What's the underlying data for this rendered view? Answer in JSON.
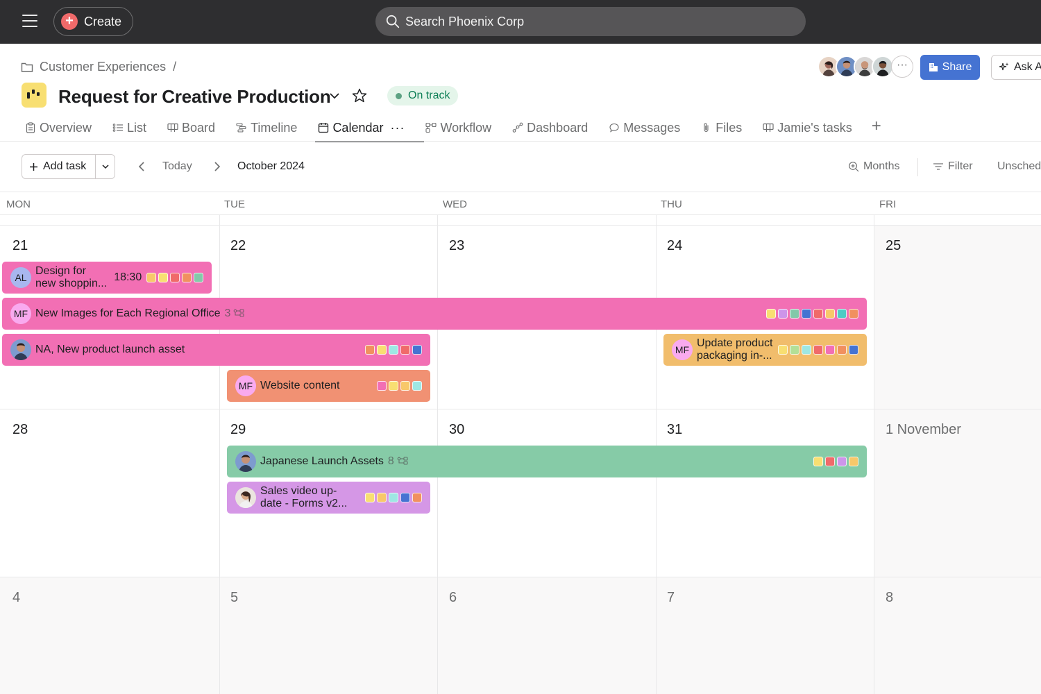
{
  "topbar": {
    "create_label": "Create",
    "search_placeholder": "Search Phoenix Corp"
  },
  "breadcrumb": {
    "parent": "Customer Experiences",
    "separator": "/"
  },
  "project": {
    "title": "Request for Creative Production",
    "status": "On track",
    "status_color": "#5da283",
    "share_label": "Share",
    "ask_label": "Ask AI"
  },
  "tabs": [
    {
      "label": "Overview",
      "icon": "clipboard-icon"
    },
    {
      "label": "List",
      "icon": "list-icon"
    },
    {
      "label": "Board",
      "icon": "board-icon"
    },
    {
      "label": "Timeline",
      "icon": "timeline-icon"
    },
    {
      "label": "Calendar",
      "icon": "calendar-icon",
      "active": true
    },
    {
      "label": "Workflow",
      "icon": "workflow-icon"
    },
    {
      "label": "Dashboard",
      "icon": "dashboard-icon"
    },
    {
      "label": "Messages",
      "icon": "message-icon"
    },
    {
      "label": "Files",
      "icon": "paperclip-icon"
    },
    {
      "label": "Jamie's tasks",
      "icon": "board-icon"
    }
  ],
  "toolbar": {
    "add_task": "Add task",
    "today": "Today",
    "month": "October 2024",
    "months": "Months",
    "filter": "Filter",
    "unscheduled": "Unscheduled"
  },
  "calendar": {
    "weekdays": [
      "MON",
      "TUE",
      "WED",
      "THU",
      "FRI"
    ],
    "weeks": [
      [
        "21",
        "22",
        "23",
        "24",
        "25"
      ],
      [
        "28",
        "29",
        "30",
        "31",
        "1 November"
      ],
      [
        "4",
        "5",
        "6",
        "7",
        "8"
      ]
    ]
  },
  "tasks": [
    {
      "title_line1": "Design for",
      "title_line2": "new shoppin...",
      "time": "18:30",
      "assignee": "AL",
      "color": "#f26fb4",
      "tags": [
        "#f8c86a",
        "#f8df72",
        "#f06a6a",
        "#f1905f",
        "#83c9a9"
      ]
    },
    {
      "title": "New Images for Each Regional Office",
      "subtasks": "3",
      "assignee": "MF",
      "color": "#f26fb4",
      "tags": [
        "#f8df72",
        "#cd95ea",
        "#83c9a9",
        "#4573d2",
        "#f06a6a",
        "#f8c86a",
        "#4ecbc4",
        "#f1905f"
      ]
    },
    {
      "title": "NA, New product launch asset",
      "color": "#f26fb4",
      "tags": [
        "#f1905f",
        "#f8df72",
        "#9ee7e3",
        "#f06a6a",
        "#4573d2"
      ]
    },
    {
      "title": "Website content",
      "assignee": "MF",
      "color": "#f19173",
      "tags": [
        "#f26fb4",
        "#f8df72",
        "#f8c86a",
        "#9ee7e3"
      ]
    },
    {
      "title_line1": "Update product",
      "title_line2": "packaging in-...",
      "assignee": "MF",
      "color": "#f1bd6c",
      "tags": [
        "#f8df72",
        "#b3df97",
        "#9ee7e3",
        "#f06a6a",
        "#f26fb4",
        "#f1905f",
        "#4573d2"
      ]
    },
    {
      "title": "Japanese Launch Assets",
      "subtasks": "8",
      "color": "#86cba7",
      "tags": [
        "#f8df72",
        "#f06a6a",
        "#cd95ea",
        "#f8c86a"
      ]
    },
    {
      "title_line1": "Sales video up-",
      "title_line2": "date - Forms v2...",
      "color": "#d597e6",
      "tags": [
        "#f8df72",
        "#f8c86a",
        "#9ee7e3",
        "#4573d2",
        "#f1905f"
      ]
    }
  ]
}
